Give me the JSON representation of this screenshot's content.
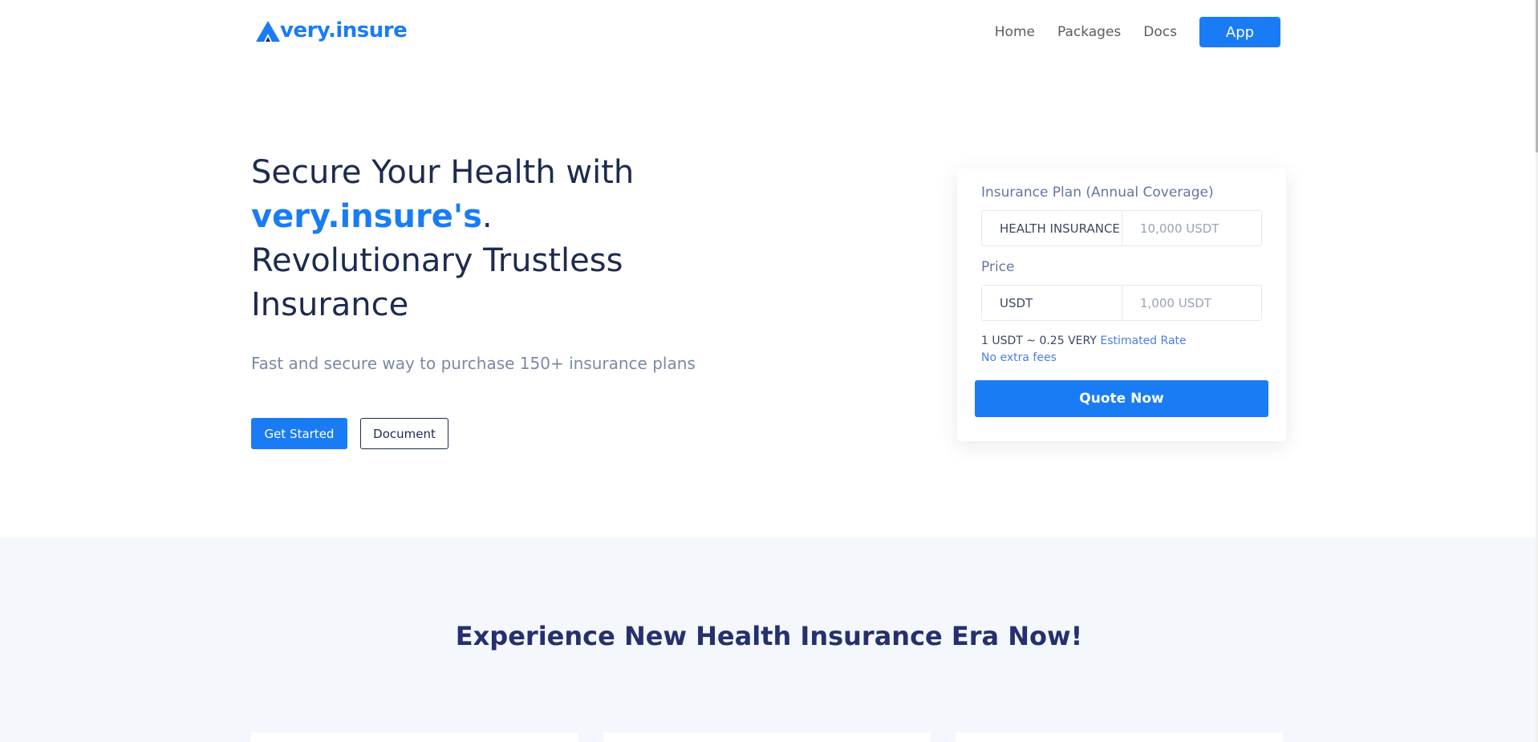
{
  "nav": {
    "logo_text": "very.insure",
    "links": [
      "Home",
      "Packages",
      "Docs"
    ],
    "app_button": "App"
  },
  "hero": {
    "title_line1": "Secure Your Health with",
    "title_brand": "very.insure's",
    "title_brand_suffix": ".",
    "title_line3": "Revolutionary Trustless",
    "title_line4": "Insurance",
    "subtitle": "Fast and secure way to purchase 150+ insurance plans",
    "cta_primary": "Get Started",
    "cta_secondary": "Document"
  },
  "quote_card": {
    "plan_label": "Insurance Plan (Annual Coverage)",
    "plan_value": "HEALTH INSURANCE",
    "coverage_value": "10,000 USDT",
    "price_label": "Price",
    "price_currency": "USDT",
    "price_value": "1,000 USDT",
    "rate_text": "1 USDT ~ 0.25 VERY",
    "rate_note": "Estimated Rate",
    "fees_note": "No extra fees",
    "quote_button": "Quote Now"
  },
  "section": {
    "title": "Experience New Health Insurance Era Now!"
  },
  "colors": {
    "brand": "#1a7cf5",
    "heading": "#1d2b4f",
    "section_bg": "#f4f7fb"
  }
}
